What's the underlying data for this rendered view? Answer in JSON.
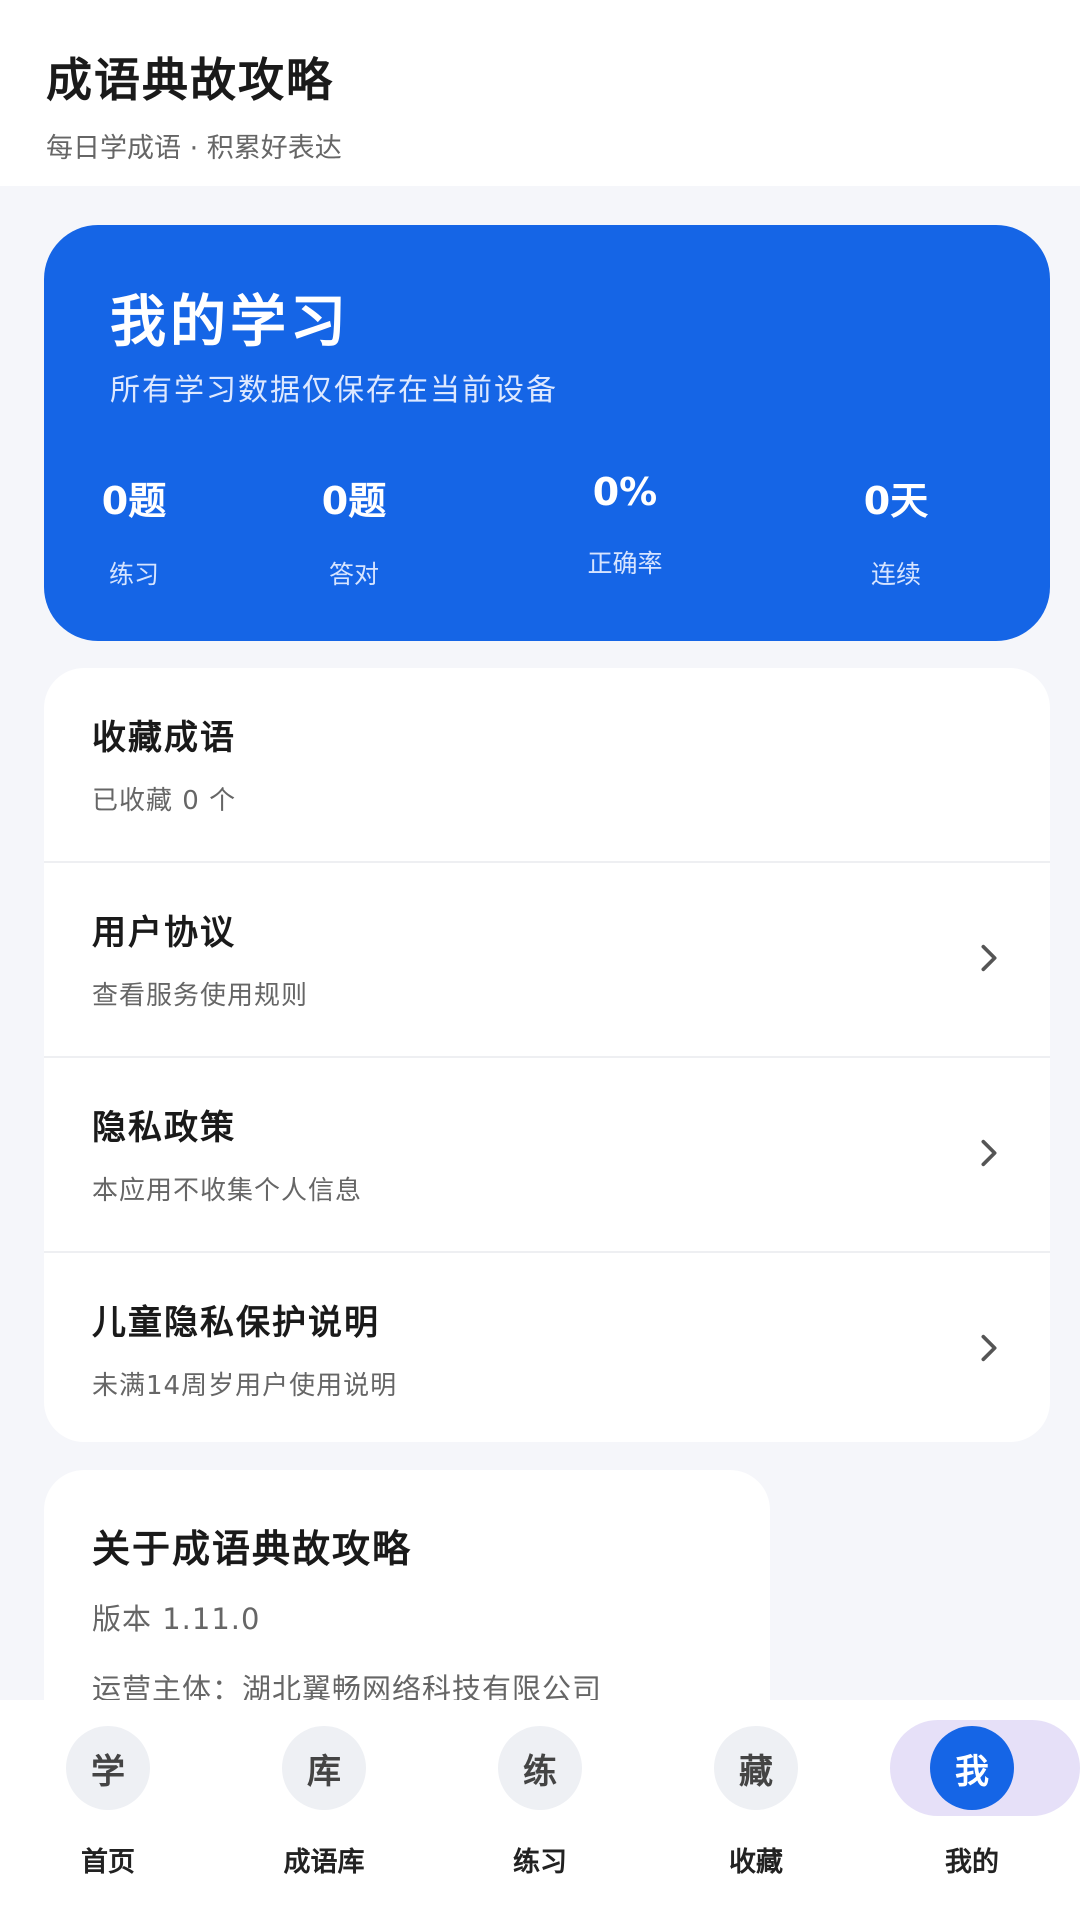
{
  "header": {
    "title": "成语典故攻略",
    "subtitle": "每日学成语 · 积累好表达"
  },
  "stats": {
    "title": "我的学习",
    "note": "所有学习数据仅保存在当前设备",
    "items": [
      {
        "value": "0题",
        "label": "练习"
      },
      {
        "value": "0题",
        "label": "答对"
      },
      {
        "value": "0%",
        "label": "正确率"
      },
      {
        "value": "0天",
        "label": "连续"
      }
    ]
  },
  "menu": [
    {
      "title": "收藏成语",
      "subtitle": "已收藏 0 个",
      "chevron": false
    },
    {
      "title": "用户协议",
      "subtitle": "查看服务使用规则",
      "chevron": true,
      "icon": "chevron-right-icon"
    },
    {
      "title": "隐私政策",
      "subtitle": "本应用不收集个人信息",
      "chevron": true,
      "icon": "chevron-right-icon"
    },
    {
      "title": "儿童隐私保护说明",
      "subtitle": "未满14周岁用户使用说明",
      "chevron": true,
      "icon": "chevron-right-icon"
    }
  ],
  "about": {
    "title": "关于成语典故攻略",
    "version": "版本 1.11.0",
    "operator": "运营主体：湖北翼畅网络科技有限公司"
  },
  "tabs": [
    {
      "icon_text": "学",
      "label": "首页"
    },
    {
      "icon_text": "库",
      "label": "成语库"
    },
    {
      "icon_text": "练",
      "label": "练习"
    },
    {
      "icon_text": "藏",
      "label": "收藏"
    },
    {
      "icon_text": "我",
      "label": "我的",
      "active": true
    }
  ],
  "colors": {
    "accent": "#1565e6",
    "active_tab_pill": "#e6e0f8",
    "background": "#f5f6fa"
  }
}
